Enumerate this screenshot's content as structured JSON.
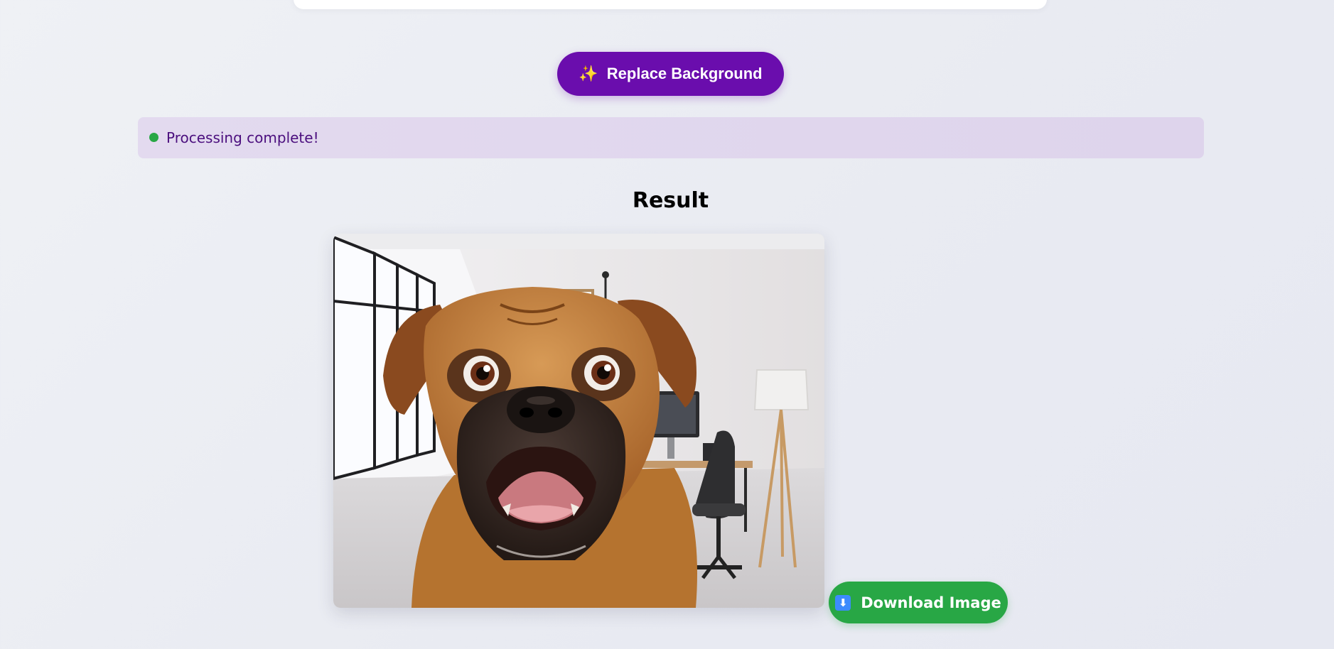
{
  "actions": {
    "replace_label": "Replace Background",
    "replace_icon": "sparkles-icon",
    "download_label": "Download Image",
    "download_icon": "download-arrow-icon"
  },
  "status": {
    "text": "Processing complete!",
    "indicator_color": "#28a745"
  },
  "result": {
    "title": "Result",
    "image_subject": "dog with a surprised face composited over a bright office interior"
  },
  "colors": {
    "primary": "#6a0dad",
    "success": "#28a745",
    "status_bg": "#e3daef",
    "status_text": "#4b0f7e"
  }
}
